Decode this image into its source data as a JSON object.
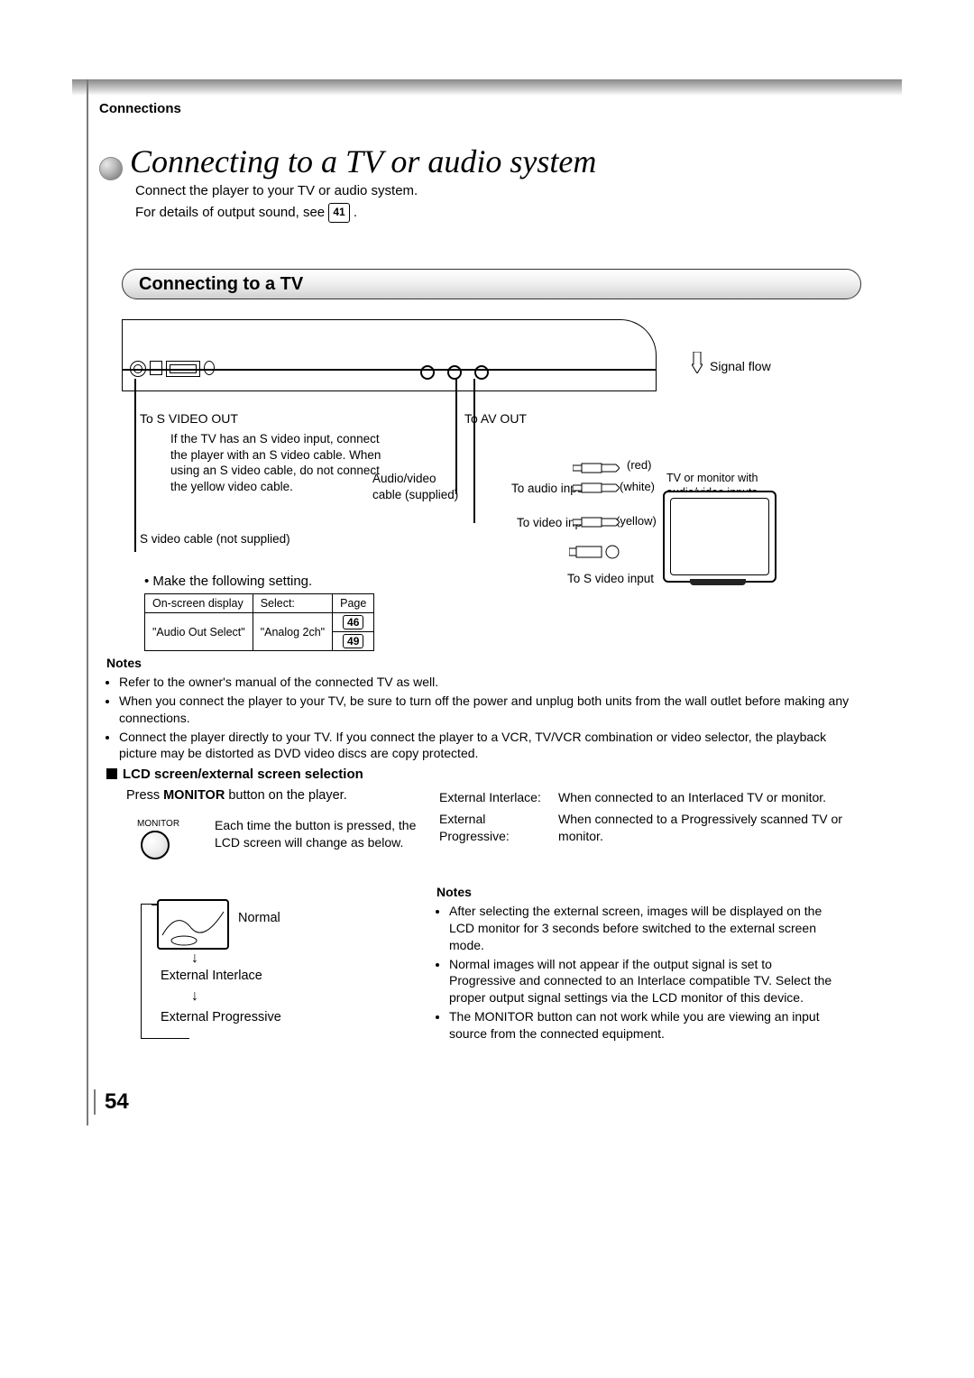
{
  "section_label": "Connections",
  "page_title": "Connecting to a TV or audio system",
  "intro_line1": "Connect the player to your TV or audio system.",
  "intro_line2a": "For details of output sound, see ",
  "intro_pageref": "41",
  "intro_line2b": " .",
  "subhead": "Connecting to a TV",
  "diagram": {
    "signal_flow": "Signal flow",
    "s_video_out": "To S VIDEO OUT",
    "s_video_note": "If the TV has an S video input, connect the player with an S video cable. When using an S video cable, do not connect the yellow video cable.",
    "av_out": "To AV OUT",
    "av_cable": "Audio/video cable (supplied)",
    "red": "(red)",
    "white": "(white)",
    "yellow": "(yellow)",
    "to_audio": "To audio inputs",
    "to_video": "To video input",
    "tv_monitor": "TV or monitor with audio/video inputs",
    "s_video_cable": "S video cable (not supplied)",
    "s_video_in": "To S video input"
  },
  "setting_bullet": "• Make the following setting.",
  "setting_table": {
    "h1": "On-screen display",
    "h2": "Select:",
    "h3": "Page",
    "r1c1": "\"Audio Out Select\"",
    "r1c2": "\"Analog 2ch\"",
    "page1": "46",
    "page2": "49"
  },
  "notes1_heading": "Notes",
  "notes1": [
    "Refer to the owner's manual of the connected TV as well.",
    "When you connect the player to your TV, be sure to turn off the power and unplug both units from the wall outlet before making any connections.",
    "Connect the player directly to your TV.  If you connect the player to a VCR, TV/VCR combination or video selector, the playback picture may be distorted as DVD video discs are copy protected."
  ],
  "lcd_heading": "LCD screen/external screen selection",
  "lcd_press_a": "Press ",
  "lcd_press_b": "MONITOR",
  "lcd_press_c": " button on the player.",
  "monitor_label": "MONITOR",
  "monitor_desc": "Each time the button is pressed, the LCD screen will change as below.",
  "right_modes": {
    "ei_label": "External Interlace:",
    "ei_desc": "When connected to an Interlaced TV or monitor.",
    "ep_label": "External Progressive:",
    "ep_desc": "When connected to a Progressively scanned TV or monitor."
  },
  "modes": {
    "normal": "Normal",
    "ei": "External Interlace",
    "ep": "External Progressive"
  },
  "notes2_heading": "Notes",
  "notes2": [
    "After selecting the external screen, images will be displayed on the LCD monitor for 3 seconds before switched to the external screen mode.",
    "Normal images will not appear if the output signal is set to Progressive and connected to an Interlace compatible TV. Select the proper output signal settings via the LCD monitor of this device.",
    "The MONITOR button can not work while you are viewing an input source from the connected equipment."
  ],
  "page_number": "54"
}
